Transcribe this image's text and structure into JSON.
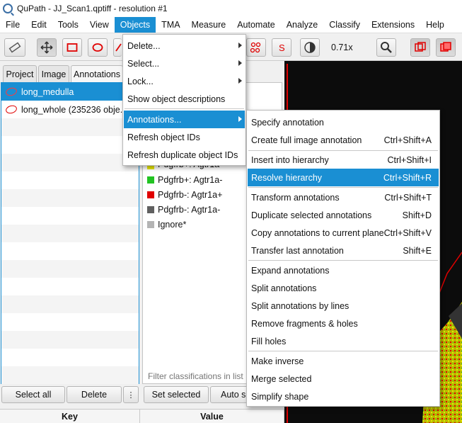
{
  "window": {
    "title": "QuPath - JJ_Scan1.qptiff - resolution #1"
  },
  "menubar": [
    "File",
    "Edit",
    "Tools",
    "View",
    "Objects",
    "TMA",
    "Measure",
    "Automate",
    "Analyze",
    "Classify",
    "Extensions",
    "Help"
  ],
  "toolbar": {
    "zoom": "0.71x"
  },
  "tabs": [
    "Project",
    "Image",
    "Annotations"
  ],
  "annotations": [
    "long_medulla",
    "long_whole (235236 obje..."
  ],
  "left_buttons": {
    "select_all": "Select all",
    "delete": "Delete",
    "more": "⋮"
  },
  "classes": [
    {
      "name": "Pdgfrb+: Agtr1a-",
      "color": "#e8e800"
    },
    {
      "name": "Pdgfrb+: Agtr1a-",
      "color": "#22c322"
    },
    {
      "name": "Pdgfrb-: Agtr1a+",
      "color": "#e00000"
    },
    {
      "name": "Pdgfrb-: Agtr1a-",
      "color": "#606060"
    },
    {
      "name": "Ignore*",
      "color": "#b4b4b4"
    }
  ],
  "class_panel": {
    "filter_placeholder": "Filter classifications in list",
    "set_selected": "Set selected",
    "auto_set": "Auto s"
  },
  "kv_header": {
    "key": "Key",
    "value": "Value"
  },
  "objects_menu": [
    {
      "label": "Delete...",
      "submenu": true
    },
    {
      "label": "Select...",
      "submenu": true
    },
    {
      "label": "Lock...",
      "submenu": true
    },
    {
      "label": "Show object descriptions"
    },
    {
      "label": "Annotations...",
      "submenu": true,
      "highlight": true
    },
    {
      "label": "Refresh object IDs"
    },
    {
      "label": "Refresh duplicate object IDs"
    }
  ],
  "annotations_submenu": [
    {
      "label": "Specify annotation",
      "accel": ""
    },
    {
      "label": "Create full image annotation",
      "accel": "Ctrl+Shift+A"
    },
    {
      "separator": true
    },
    {
      "label": "Insert into hierarchy",
      "accel": "Ctrl+Shift+I"
    },
    {
      "label": "Resolve hierarchy",
      "accel": "Ctrl+Shift+R",
      "highlight": true
    },
    {
      "separator": true
    },
    {
      "label": "Transform annotations",
      "accel": "Ctrl+Shift+T"
    },
    {
      "label": "Duplicate selected annotations",
      "accel": "Shift+D"
    },
    {
      "label": "Copy annotations to current plane",
      "accel": "Ctrl+Shift+V"
    },
    {
      "label": "Transfer last annotation",
      "accel": "Shift+E"
    },
    {
      "separator": true
    },
    {
      "label": "Expand annotations",
      "accel": ""
    },
    {
      "label": "Split annotations",
      "accel": ""
    },
    {
      "label": "Split annotations by lines",
      "accel": ""
    },
    {
      "label": "Remove fragments & holes",
      "accel": ""
    },
    {
      "label": "Fill holes",
      "accel": ""
    },
    {
      "separator": true
    },
    {
      "label": "Make inverse",
      "accel": ""
    },
    {
      "label": "Merge selected",
      "accel": ""
    },
    {
      "label": "Simplify shape",
      "accel": ""
    }
  ]
}
